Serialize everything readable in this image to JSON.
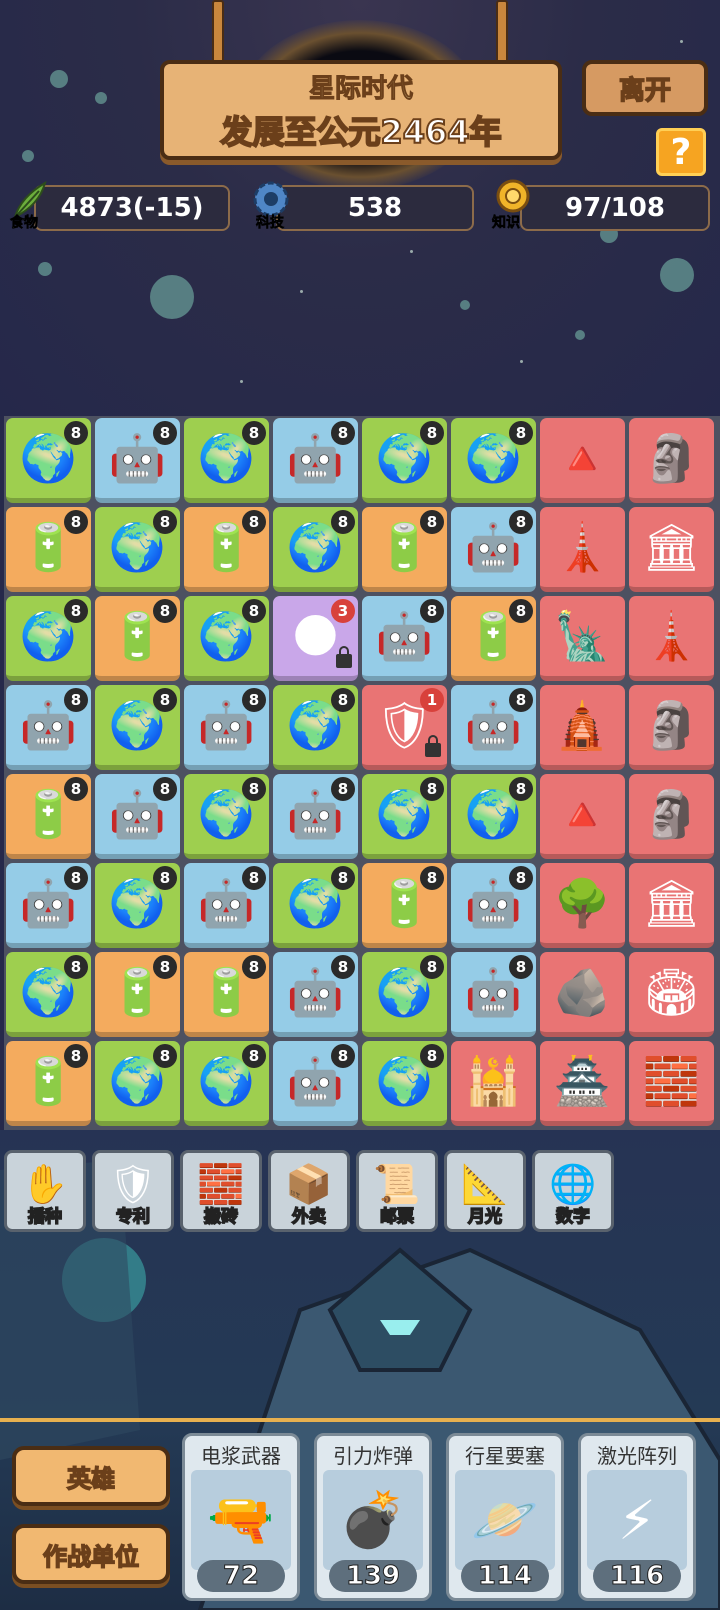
{
  "header": {
    "era": "星际时代",
    "progress": "发展至公元2464年",
    "leave_label": "离开",
    "help_label": "?"
  },
  "resources": {
    "food": {
      "label": "食物",
      "value": "4873(-15)",
      "icon": "leaf-icon",
      "color": "#6cae3c"
    },
    "tech": {
      "label": "科技",
      "value": "538",
      "icon": "gear-icon",
      "color": "#4f86c6"
    },
    "knowledge": {
      "label": "知识",
      "value": "97/108",
      "icon": "medal-icon",
      "color": "#f0b429"
    }
  },
  "tile_types": {
    "earth": {
      "icon": "earth-planet-icon",
      "glyph": "🌍",
      "color": "green"
    },
    "mecha": {
      "icon": "mecha-robot-icon",
      "glyph": "🤖",
      "color": "blue"
    },
    "battery": {
      "icon": "battery-icon",
      "glyph": "🔋",
      "color": "orange"
    },
    "asteroid": {
      "icon": "asteroid-icon",
      "glyph": "🌑",
      "color": "purple"
    },
    "knight": {
      "icon": "dark-knight-icon",
      "glyph": "🛡",
      "color": "red"
    }
  },
  "board": [
    [
      {
        "t": "earth",
        "n": "8"
      },
      {
        "t": "mecha",
        "n": "8"
      },
      {
        "t": "earth",
        "n": "8"
      },
      {
        "t": "mecha",
        "n": "8"
      },
      {
        "t": "earth",
        "n": "8"
      },
      {
        "t": "earth",
        "n": "8"
      },
      {
        "w": "pyramid"
      },
      {
        "w": "terracotta"
      }
    ],
    [
      {
        "t": "battery",
        "n": "8"
      },
      {
        "t": "earth",
        "n": "8"
      },
      {
        "t": "battery",
        "n": "8"
      },
      {
        "t": "earth",
        "n": "8"
      },
      {
        "t": "battery",
        "n": "8"
      },
      {
        "t": "mecha",
        "n": "8"
      },
      {
        "w": "eiffel"
      },
      {
        "w": "pisa"
      }
    ],
    [
      {
        "t": "earth",
        "n": "8"
      },
      {
        "t": "battery",
        "n": "8"
      },
      {
        "t": "earth",
        "n": "8"
      },
      {
        "t": "asteroid",
        "n": "3",
        "locked": true
      },
      {
        "t": "mecha",
        "n": "8"
      },
      {
        "t": "battery",
        "n": "8"
      },
      {
        "w": "liberty"
      },
      {
        "w": "lighthouse"
      }
    ],
    [
      {
        "t": "mecha",
        "n": "8"
      },
      {
        "t": "earth",
        "n": "8"
      },
      {
        "t": "mecha",
        "n": "8"
      },
      {
        "t": "earth",
        "n": "8"
      },
      {
        "t": "knight",
        "n": "1",
        "locked": true
      },
      {
        "t": "mecha",
        "n": "8"
      },
      {
        "w": "angkor"
      },
      {
        "w": "statue"
      }
    ],
    [
      {
        "t": "battery",
        "n": "8"
      },
      {
        "t": "mecha",
        "n": "8"
      },
      {
        "t": "earth",
        "n": "8"
      },
      {
        "t": "mecha",
        "n": "8"
      },
      {
        "t": "earth",
        "n": "8"
      },
      {
        "t": "earth",
        "n": "8"
      },
      {
        "w": "chichen"
      },
      {
        "w": "zeus"
      }
    ],
    [
      {
        "t": "mecha",
        "n": "8"
      },
      {
        "t": "earth",
        "n": "8"
      },
      {
        "t": "mecha",
        "n": "8"
      },
      {
        "t": "earth",
        "n": "8"
      },
      {
        "t": "battery",
        "n": "8"
      },
      {
        "t": "mecha",
        "n": "8"
      },
      {
        "w": "gardens"
      },
      {
        "w": "mausoleum"
      }
    ],
    [
      {
        "t": "earth",
        "n": "8"
      },
      {
        "t": "battery",
        "n": "8"
      },
      {
        "t": "battery",
        "n": "8"
      },
      {
        "t": "mecha",
        "n": "8"
      },
      {
        "t": "earth",
        "n": "8"
      },
      {
        "t": "mecha",
        "n": "8"
      },
      {
        "w": "stonehenge"
      },
      {
        "w": "colosseum"
      }
    ],
    [
      {
        "t": "battery",
        "n": "8"
      },
      {
        "t": "earth",
        "n": "8"
      },
      {
        "t": "earth",
        "n": "8"
      },
      {
        "t": "mecha",
        "n": "8"
      },
      {
        "t": "earth",
        "n": "8"
      },
      {
        "w": "tajmahal"
      },
      {
        "w": "forbidden-city"
      },
      {
        "w": "great-wall"
      }
    ]
  ],
  "wonders": {
    "pyramid": {
      "icon": "pyramid-icon",
      "glyph": "🔺"
    },
    "terracotta": {
      "icon": "terracotta-army-icon",
      "glyph": "🗿"
    },
    "eiffel": {
      "icon": "eiffel-tower-icon",
      "glyph": "🗼"
    },
    "pisa": {
      "icon": "leaning-tower-icon",
      "glyph": "🏛"
    },
    "liberty": {
      "icon": "statue-of-liberty-icon",
      "glyph": "🗽"
    },
    "lighthouse": {
      "icon": "lighthouse-icon",
      "glyph": "🗼"
    },
    "angkor": {
      "icon": "angkor-wat-icon",
      "glyph": "🛕"
    },
    "statue": {
      "icon": "ancient-statue-icon",
      "glyph": "🗿"
    },
    "chichen": {
      "icon": "mayan-pyramid-icon",
      "glyph": "🔺"
    },
    "zeus": {
      "icon": "zeus-statue-icon",
      "glyph": "🗿"
    },
    "gardens": {
      "icon": "hanging-gardens-icon",
      "glyph": "🌳"
    },
    "mausoleum": {
      "icon": "mausoleum-icon",
      "glyph": "🏛"
    },
    "stonehenge": {
      "icon": "stonehenge-icon",
      "glyph": "🪨"
    },
    "colosseum": {
      "icon": "colosseum-icon",
      "glyph": "🏟"
    },
    "tajmahal": {
      "icon": "taj-mahal-icon",
      "glyph": "🕌"
    },
    "forbidden-city": {
      "icon": "forbidden-city-icon",
      "glyph": "🏯"
    },
    "great-wall": {
      "icon": "great-wall-icon",
      "glyph": "🧱"
    }
  },
  "tools": [
    {
      "label": "播种",
      "icon": "hand-sow-icon",
      "glyph": "✋"
    },
    {
      "label": "专利",
      "icon": "patent-badge-icon",
      "glyph": "🛡"
    },
    {
      "label": "搬砖",
      "icon": "bricks-icon",
      "glyph": "🧱"
    },
    {
      "label": "外卖",
      "icon": "delivery-box-icon",
      "glyph": "📦"
    },
    {
      "label": "邮票",
      "icon": "stamp-icon",
      "glyph": "📜"
    },
    {
      "label": "月光",
      "icon": "moonlight-box-icon",
      "glyph": "📐"
    },
    {
      "label": "数字",
      "icon": "digital-globe-icon",
      "glyph": "🌐"
    }
  ],
  "side_buttons": {
    "hero": "英雄",
    "units": "作战单位"
  },
  "cards": [
    {
      "name": "电浆武器",
      "cost": "72",
      "icon": "plasma-cannon-icon",
      "glyph": "🔫"
    },
    {
      "name": "引力炸弹",
      "cost": "139",
      "icon": "gravity-bomb-icon",
      "glyph": "💣"
    },
    {
      "name": "行星要塞",
      "cost": "114",
      "icon": "planet-fortress-icon",
      "glyph": "🪐"
    },
    {
      "name": "激光阵列",
      "cost": "116",
      "icon": "laser-array-icon",
      "glyph": "⚡"
    }
  ]
}
